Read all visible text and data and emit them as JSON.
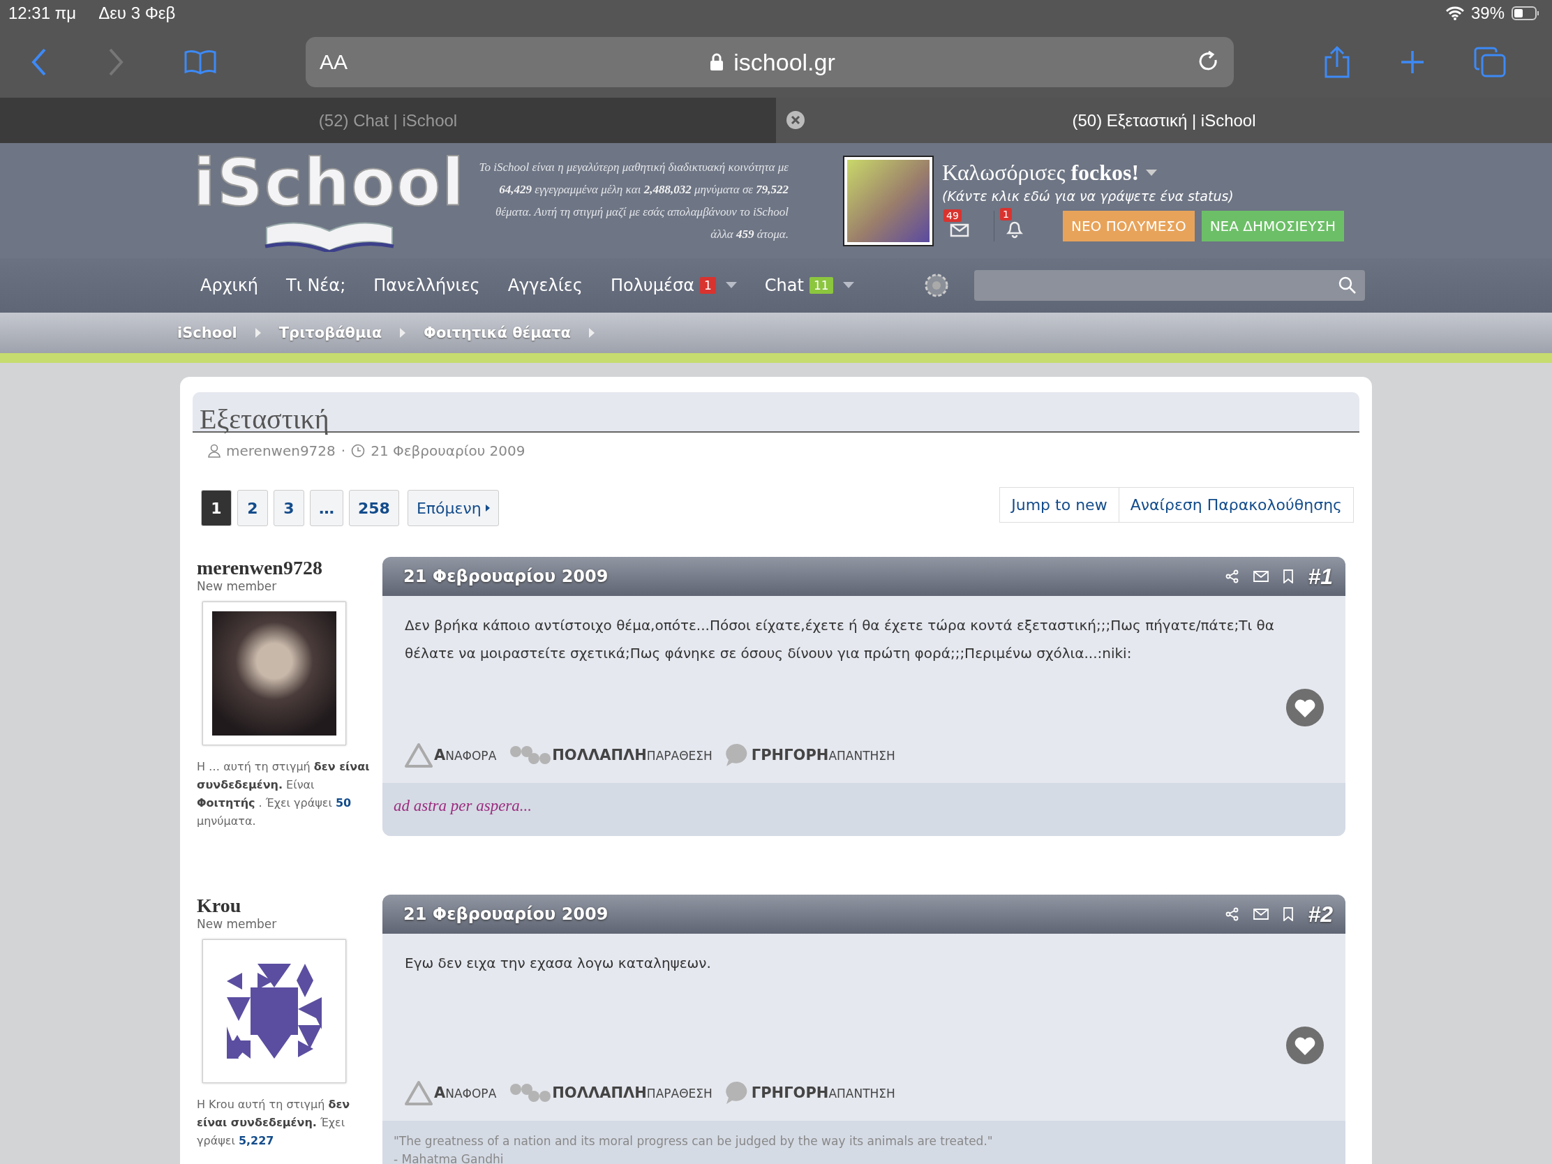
{
  "status_bar": {
    "time": "12:31 πμ",
    "date": "Δευ 3 Φεβ",
    "battery": "39%"
  },
  "browser": {
    "text_size": "AA",
    "url": "ischool.gr",
    "tabs": [
      {
        "title": "(52) Chat | iSchool",
        "selected": false
      },
      {
        "title": "(50) Εξεταστική | iSchool",
        "selected": true
      }
    ]
  },
  "site_header": {
    "logo": "iSchool",
    "stats": "Το iSchool είναι η μεγαλύτερη μαθητική διαδικτυακή κοινότητα με **64,429** εγγεγραμμένα μέλη και **2,488,032** μηνύματα σε **79,522** θέματα. Αυτή τη στιγμή μαζί με εσάς απολαμβάνουν το iSchool άλλα **459** άτομα.",
    "welcome": "Καλωσόρισες **fockos!**",
    "status_hint": "(Κάντε κλικ εδώ για να γράψετε ένα status)",
    "message_count": "49",
    "alert_count": "1",
    "buttons": [
      {
        "label": "ΝΕΟ ΠΟΛΥΜΕΣΟ",
        "color": "#e8a35a"
      },
      {
        "label": "ΝΕΑ ΔΗΜΟΣΙΕΥΣΗ",
        "color": "#6cbf67"
      }
    ]
  },
  "nav": {
    "items": [
      {
        "label": "Αρχική",
        "dropdown": false
      },
      {
        "label": "Τι Νέα;",
        "dropdown": false
      },
      {
        "label": "Πανελλήνιες",
        "dropdown": false
      },
      {
        "label": "Αγγελίες",
        "dropdown": false
      },
      {
        "label": "Πολυμέσα",
        "badge": "1",
        "color": "#d9332f",
        "dropdown": true
      },
      {
        "label": "Chat",
        "badge": "11",
        "color": "#8cc63f",
        "dropdown": true
      }
    ]
  },
  "breadcrumb": [
    "iSchool",
    "Τριτοβάθμια",
    "Φοιτητικά θέματα"
  ],
  "thread": {
    "title": "Εξεταστική",
    "author": "merenwen9728",
    "separator": "·",
    "date": "21 Φεβρουαρίου 2009",
    "pages": [
      {
        "label": "1",
        "selected": true
      },
      {
        "label": "2",
        "selected": false
      },
      {
        "label": "3",
        "selected": false
      },
      {
        "label": "…",
        "selected": false
      },
      {
        "label": "258",
        "selected": false
      }
    ],
    "next": "Επόμενη",
    "actions": [
      "Jump to new",
      "Αναίρεση Παρακολούθησης"
    ]
  },
  "posts": [
    {
      "author": "merenwen9728",
      "role": "New member",
      "avatar": {
        "kind": "photo"
      },
      "info": "Η … αυτή τη στιγμή **δεν είναι συνδεδεμένη.** Είναι **Φοιτητής** . Έχει γράψει",
      "count": "50",
      "info_end": "μηνύματα.",
      "date": "21 Φεβρουαρίου 2009",
      "number": "#1",
      "body": "Δεν βρήκα κάποιο αντίστοιχο θέμα,οπότε...Πόσοι είχατε,έχετε ή θα έχετε τώρα κοντά εξεταστική;;;Πως πήγατε/πάτε;Τι θα θέλατε να μοιραστείτε σχετικά;Πως φάνηκε σε όσους δίνουν για πρώτη φορά;;;Περιμένω σχόλια...:niki:",
      "actions": [
        "**Α**ΝΑΦΟΡΑ",
        "**ΠΟΛΛΑΠΛΗ**ΠΑΡΑΘΕΣΗ",
        "**ΓΡΗΓΟΡΗ**ΑΠΑΝΤΗΣΗ"
      ],
      "signature": {
        "kind": "motto",
        "lines": [
          "ad astra per aspera..."
        ]
      }
    },
    {
      "author": "Krou",
      "role": "New member",
      "avatar": {
        "kind": "identicon"
      },
      "info": "Η Krou αυτή τη στιγμή **δεν είναι συνδεδεμένη.** Έχει γράψει",
      "count": "5,227",
      "date": "21 Φεβρουαρίου 2009",
      "number": "#2",
      "body": "Εγω δεν ειχα την εχασα λογω καταληψεων.",
      "actions": [
        "**Α**ΝΑΦΟΡΑ",
        "**ΠΟΛΛΑΠΛΗ**ΠΑΡΑΘΕΣΗ",
        "**ΓΡΗΓΟΡΗ**ΑΠΑΝΤΗΣΗ"
      ],
      "signature": {
        "kind": "quote",
        "lines": [
          "\"The greatness of a nation and its moral progress can be judged by the way its animals are treated.\"",
          "- Mahatma Gandhi"
        ]
      }
    }
  ]
}
